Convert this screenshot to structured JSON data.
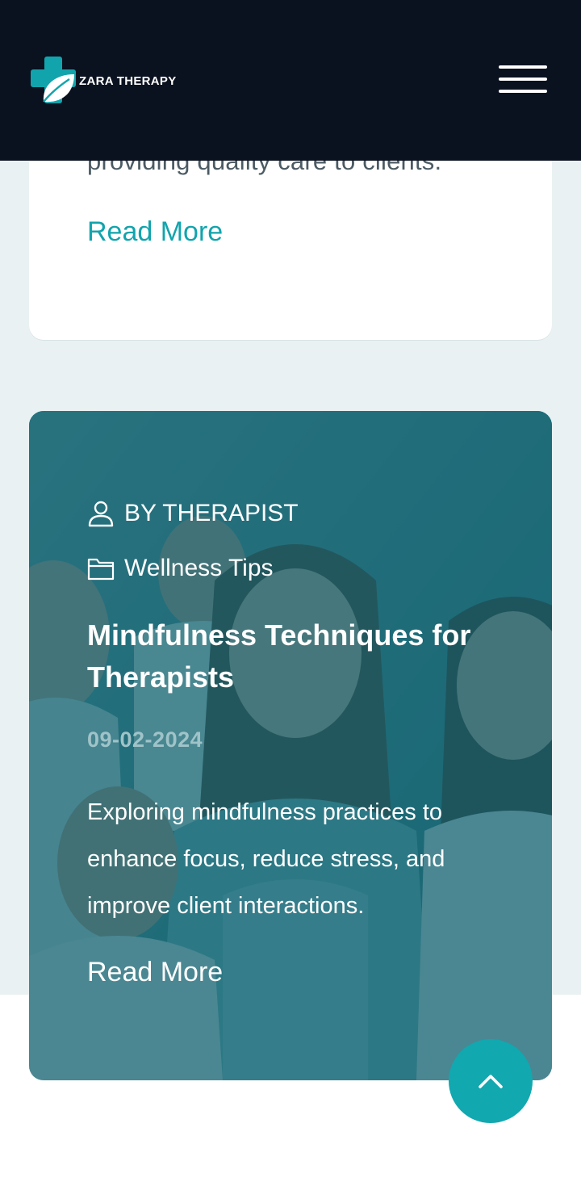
{
  "header": {
    "logo_text": "ZARA THERAPY",
    "menu_icon": "hamburger-menu-icon"
  },
  "previous_post": {
    "excerpt_tail": "providing quality care to clients.",
    "read_more": "Read More"
  },
  "featured_post": {
    "author": "BY THERAPIST",
    "author_icon": "user-icon",
    "category": "Wellness Tips",
    "category_icon": "folder-icon",
    "title": "Mindfulness Techniques for Therapists",
    "date": "09-02-2024",
    "excerpt": "Exploring mindfulness practices to enhance focus, reduce stress, and improve client interactions.",
    "read_more": "Read More"
  },
  "scroll_top": {
    "icon": "chevron-up-icon"
  },
  "colors": {
    "header_bg": "#0a111f",
    "accent": "#12a4ad",
    "card_overlay": "#0e606e",
    "page_band": "#eaf1f2"
  }
}
